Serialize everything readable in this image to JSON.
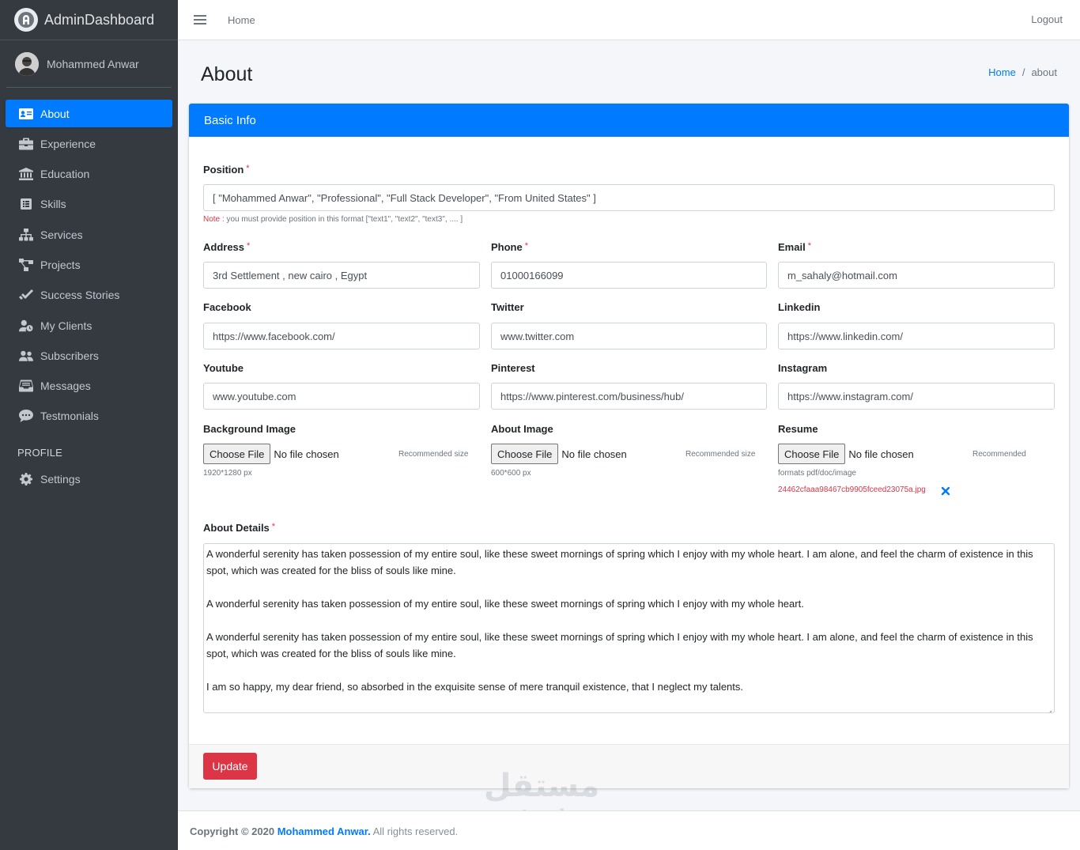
{
  "brand": {
    "name": "AdminDashboard"
  },
  "user": {
    "name": "Mohammed Anwar"
  },
  "sidebar": {
    "items": [
      {
        "label": "About",
        "icon": "id-card-icon",
        "active": true
      },
      {
        "label": "Experience",
        "icon": "briefcase-icon"
      },
      {
        "label": "Education",
        "icon": "university-icon"
      },
      {
        "label": "Skills",
        "icon": "list-alt-icon"
      },
      {
        "label": "Services",
        "icon": "sitemap-icon"
      },
      {
        "label": "Projects",
        "icon": "project-diagram-icon"
      },
      {
        "label": "Success Stories",
        "icon": "check-double-icon"
      },
      {
        "label": "My Clients",
        "icon": "user-clock-icon"
      },
      {
        "label": "Subscribers",
        "icon": "users-icon"
      },
      {
        "label": "Messages",
        "icon": "inbox-icon"
      },
      {
        "label": "Testmonials",
        "icon": "comment-dots-icon"
      }
    ],
    "profile_header": "PROFILE",
    "profile_items": [
      {
        "label": "Settings",
        "icon": "gear-icon"
      }
    ]
  },
  "topbar": {
    "home": "Home",
    "logout": "Logout"
  },
  "page": {
    "title": "About"
  },
  "breadcrumb": {
    "home": "Home",
    "separator": "/",
    "current": "about"
  },
  "card": {
    "title": "Basic Info"
  },
  "form": {
    "position": {
      "label": "Position",
      "value": "[ \"Mohammed Anwar\", \"Professional\", \"Full Stack Developer\", \"From United States\" ]",
      "note_key": "Note :",
      "note_text": " you must provide position in this format [\"text1\", \"text2\", \"text3\", .... ]"
    },
    "address": {
      "label": "Address",
      "value": "3rd Settlement , new cairo , Egypt"
    },
    "phone": {
      "label": "Phone",
      "value": "01000166099"
    },
    "email": {
      "label": "Email",
      "value": "m_sahaly@hotmail.com"
    },
    "facebook": {
      "label": "Facebook",
      "value": "https://www.facebook.com/"
    },
    "twitter": {
      "label": "Twitter",
      "value": "www.twitter.com"
    },
    "linkedin": {
      "label": "Linkedin",
      "value": "https://www.linkedin.com/"
    },
    "youtube": {
      "label": "Youtube",
      "value": "www.youtube.com"
    },
    "pinterest": {
      "label": "Pinterest",
      "value": "https://www.pinterest.com/business/hub/"
    },
    "instagram": {
      "label": "Instagram",
      "value": "https://www.instagram.com/"
    },
    "background_image": {
      "label": "Background Image",
      "button": "Choose File",
      "status": "No file chosen",
      "hint1": "Recommended size",
      "hint2": "1920*1280 px"
    },
    "about_image": {
      "label": "About Image",
      "button": "Choose File",
      "status": "No file chosen",
      "hint1": "Recommended size",
      "hint2": "600*600 px"
    },
    "resume": {
      "label": "Resume",
      "button": "Choose File",
      "status": "No file chosen",
      "hint1": "Recommended",
      "hint2": "formats pdf/doc/image",
      "current_file": "24462cfaaa98467cb9905fceed23075a.jpg"
    },
    "about_details": {
      "label": "About Details",
      "paragraphs": [
        "A wonderful serenity has taken possession of my entire soul, like these sweet mornings of spring which I enjoy with my whole heart. I am alone, and feel the charm of existence in this spot, which was created for the bliss of souls like mine.",
        "A wonderful serenity has taken possession of my entire soul, like these sweet mornings of spring which I enjoy with my whole heart.",
        "A wonderful serenity has taken possession of my entire soul, like these sweet mornings of spring which I enjoy with my whole heart. I am alone, and feel the charm of existence in this spot, which was created for the bliss of souls like mine.",
        "I am so happy, my dear friend, so absorbed in the exquisite sense of mere tranquil existence, that I neglect my talents."
      ]
    },
    "update_button": "Update"
  },
  "footer": {
    "prefix": "Copyright © 2020 ",
    "name": "Mohammed Anwar.",
    "suffix": " All rights reserved."
  },
  "watermark": {
    "arabic": "مستقل",
    "latin": "mostaql.com"
  },
  "colors": {
    "primary": "#007bff",
    "danger": "#dc3545",
    "sidebar": "#343a40"
  }
}
